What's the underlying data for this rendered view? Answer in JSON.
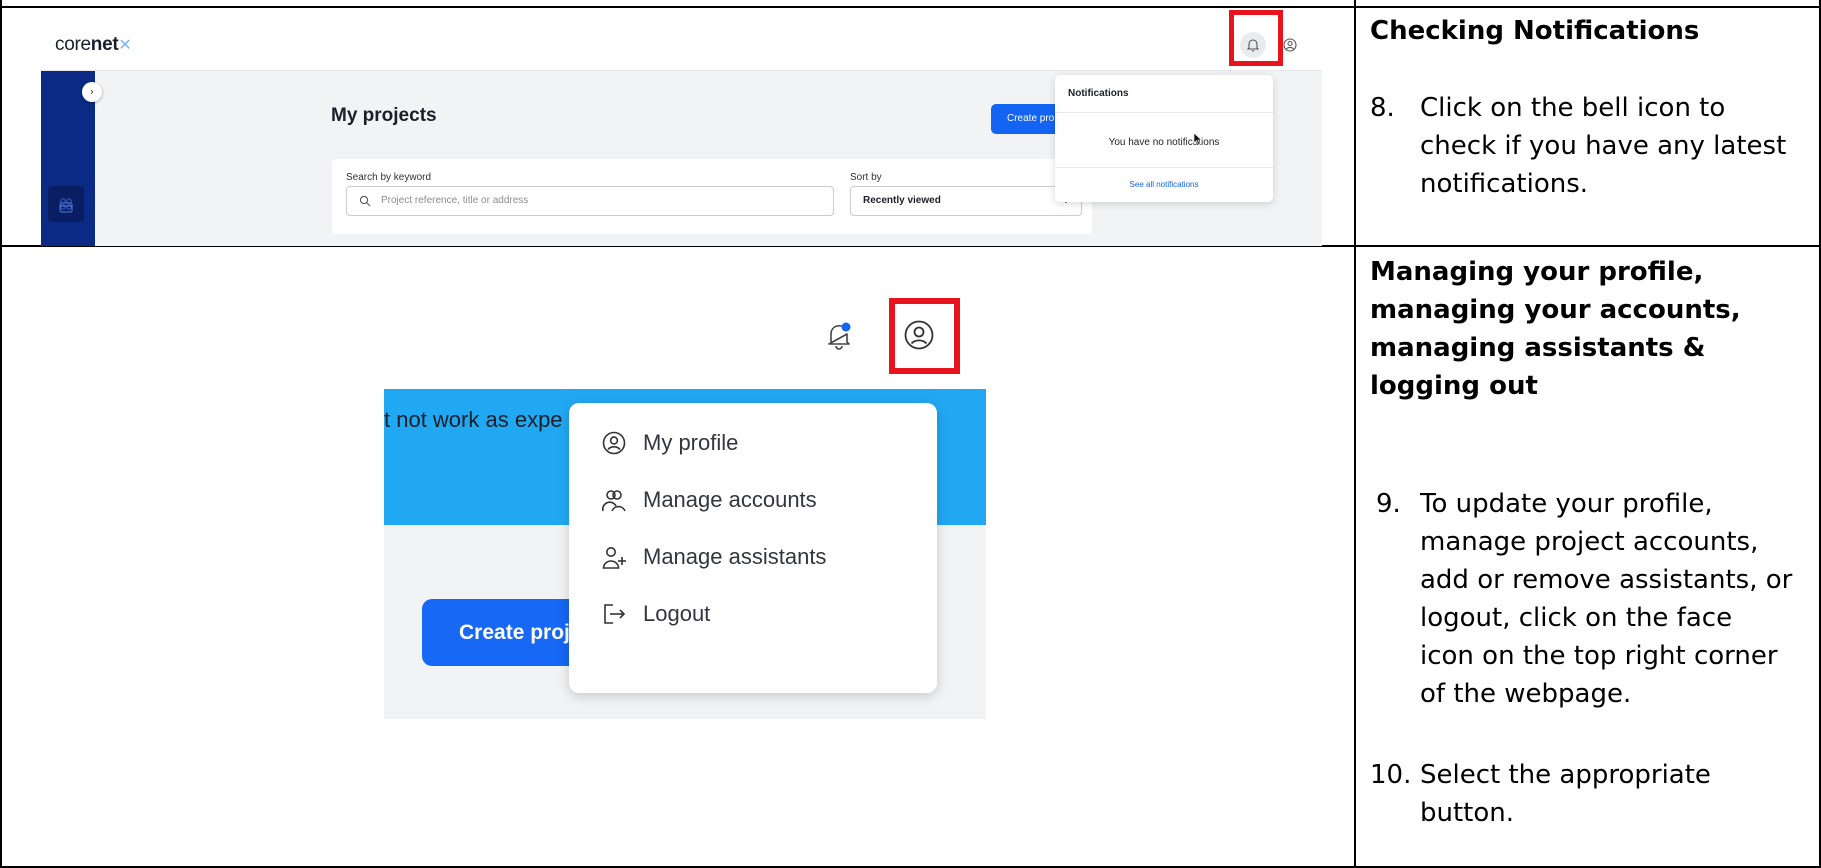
{
  "row1": {
    "heading": "Checking Notifications",
    "steps": [
      {
        "num": "8.",
        "lines": [
          "Click on the bell icon to",
          "check if you have any latest",
          "notifications."
        ]
      }
    ],
    "screenshot": {
      "logo_part1": "core",
      "logo_part2": "net",
      "page_title": "My projects",
      "create_button": "Create pro",
      "search_label": "Search by keyword",
      "search_placeholder": "Project reference, title or address",
      "sort_label": "Sort by",
      "sort_value": "Recently viewed",
      "notifications": {
        "title": "Notifications",
        "empty_message": "You have no notifications",
        "see_all_link": "See all notifications"
      }
    }
  },
  "row2": {
    "heading_lines": [
      "Managing your profile,",
      "managing your accounts,",
      "managing assistants &",
      "logging out"
    ],
    "steps": [
      {
        "num": "9.",
        "lines": [
          "To update your profile,",
          "manage project accounts,",
          "add or remove assistants, or",
          "logout, click on the face",
          "icon on the top right corner",
          "of the webpage."
        ]
      },
      {
        "num": "10.",
        "lines": [
          "Select the appropriate",
          "button."
        ]
      }
    ],
    "screenshot": {
      "banner_text": "t not work as expe",
      "create_button": "Create proj",
      "menu": [
        {
          "label": "My profile",
          "icon": "user-circle-icon"
        },
        {
          "label": "Manage accounts",
          "icon": "users-icon"
        },
        {
          "label": "Manage assistants",
          "icon": "user-plus-icon"
        },
        {
          "label": "Logout",
          "icon": "logout-icon"
        }
      ]
    }
  },
  "colors": {
    "highlight": "#e8141d",
    "primary_blue": "#1464f4",
    "sidebar_navy": "#0b2a86",
    "banner_blue": "#21a8f3"
  }
}
